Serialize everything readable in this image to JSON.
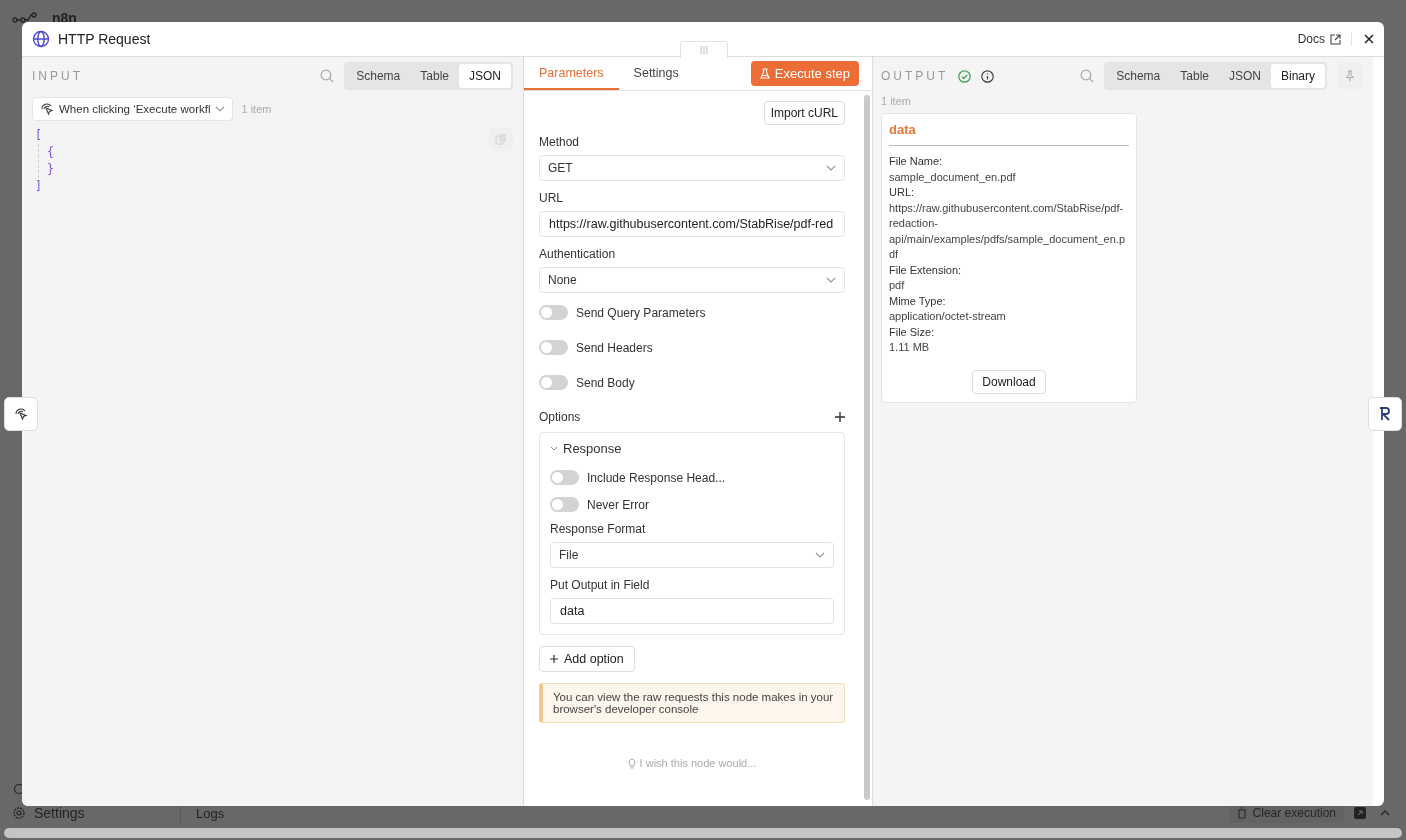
{
  "background": {
    "app_name": "n8n",
    "sidebar_item": "Settings",
    "logs_label": "Logs",
    "clear_button": "Clear execution"
  },
  "window": {
    "title": "HTTP Request",
    "docs_link": "Docs"
  },
  "input_panel": {
    "heading": "INPUT",
    "view_tabs": [
      {
        "label": "Schema",
        "selected": false
      },
      {
        "label": "Table",
        "selected": false
      },
      {
        "label": "JSON",
        "selected": true
      }
    ],
    "node_select": "When clicking ‘Execute workfl",
    "item_count": "1 item",
    "json_tree": {
      "open": "[",
      "close": "]",
      "children": [
        {
          "open": "{",
          "close": "}"
        }
      ]
    }
  },
  "parameters_panel": {
    "tabs": [
      {
        "label": "Parameters",
        "selected": true
      },
      {
        "label": "Settings",
        "selected": false
      }
    ],
    "execute_button": "Execute step",
    "import_button": "Import cURL",
    "fields": [
      {
        "kind": "select",
        "label": "Method",
        "value": "GET"
      },
      {
        "kind": "text",
        "label": "URL",
        "value": "https://raw.githubusercontent.com/StabRise/pdf-red"
      },
      {
        "kind": "select",
        "label": "Authentication",
        "value": "None"
      },
      {
        "kind": "toggle",
        "label": "Send Query Parameters",
        "on": false
      },
      {
        "kind": "toggle",
        "label": "Send Headers",
        "on": false
      },
      {
        "kind": "toggle",
        "label": "Send Body",
        "on": false
      }
    ],
    "options_label": "Options",
    "collection": {
      "title": "Response",
      "expanded": true,
      "fields": [
        {
          "kind": "toggle",
          "label": "Include Response Head...",
          "on": false
        },
        {
          "kind": "toggle",
          "label": "Never Error",
          "on": false
        },
        {
          "kind": "select",
          "label": "Response Format",
          "value": "File"
        },
        {
          "kind": "text",
          "label": "Put Output in Field",
          "value": "data"
        }
      ]
    },
    "add_option_button": "Add option",
    "notice": "You can view the raw requests this node makes in your browser's developer console",
    "feedback_link": "I wish this node would..."
  },
  "output_panel": {
    "heading": "OUTPUT",
    "view_tabs": [
      {
        "label": "Schema",
        "selected": false
      },
      {
        "label": "Table",
        "selected": false
      },
      {
        "label": "JSON",
        "selected": false
      },
      {
        "label": "Binary",
        "selected": true
      }
    ],
    "item_count": "1 item",
    "binary_card": {
      "title": "data",
      "fields": [
        {
          "label": "File Name:",
          "value": "sample_document_en.pdf"
        },
        {
          "label": "URL:",
          "value": "https://raw.githubusercontent.com/StabRise/pdf-redaction-api/main/examples/pdfs/sample_document_en.pdf"
        },
        {
          "label": "File Extension:",
          "value": "pdf"
        },
        {
          "label": "Mime Type:",
          "value": "application/octet-stream"
        },
        {
          "label": "File Size:",
          "value": "1.11 MB"
        }
      ],
      "download_button": "Download"
    }
  }
}
